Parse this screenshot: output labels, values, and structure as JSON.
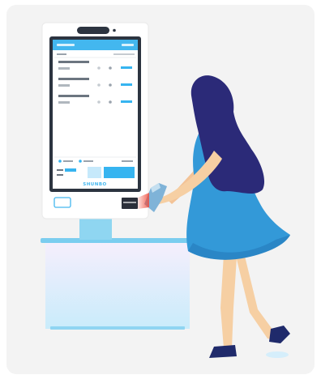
{
  "kiosk": {
    "brand_text": "SHUNBO",
    "colors": {
      "accent": "#36b4f0",
      "accent_light": "#9fdcfb",
      "header": "#43b7ef",
      "frame": "#2c3440",
      "screen_bg": "#ffffff",
      "stand": "#9adcf2",
      "counter_top": "#79cdef",
      "counter_gradient_top": "#f5edfb",
      "counter_gradient_bottom": "#cdeefb"
    },
    "list_rows": 3,
    "cart_dots": 2
  },
  "person": {
    "colors": {
      "hair": "#2b2a78",
      "dress": "#3399d8",
      "skin": "#f6cfa3",
      "shoes": "#1f2a6b",
      "shadow": "#d7effb"
    }
  },
  "scanner": {
    "colors": {
      "body": "#7fb3d8",
      "laser": "#f04b3a",
      "item": "#2b2f3a"
    }
  },
  "background": {
    "card_color": "#f3f3f3"
  }
}
